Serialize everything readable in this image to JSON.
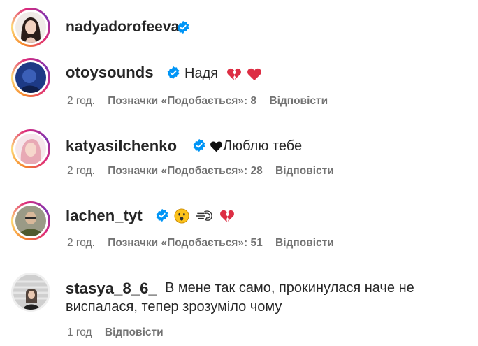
{
  "post_author": {
    "username": "nadyadorofeeva",
    "verified": true
  },
  "comments": [
    {
      "username": "otoysounds",
      "verified": true,
      "text": "Надя",
      "emojis": [
        "broken-heart-emoji",
        "red-heart-emoji"
      ],
      "time": "2 год.",
      "likes": "Позначки «Подобається»: 8",
      "reply": "Відповісти"
    },
    {
      "username": "katyasilchenko",
      "verified": true,
      "text": "Люблю тебе",
      "emojis": [
        "black-heart-emoji"
      ],
      "time": "2 год.",
      "likes": "Позначки «Подобається»: 28",
      "reply": "Відповісти"
    },
    {
      "username": "lachen_tyt",
      "verified": true,
      "text": "",
      "emojis": [
        "astonished-face-emoji",
        "dashing-away-emoji",
        "broken-heart-emoji"
      ],
      "time": "2 год.",
      "likes": "Позначки «Подобається»: 51",
      "reply": "Відповісти"
    },
    {
      "username": "stasya_8_6_",
      "verified": false,
      "text_line1": "В мене так само, прокинулася наче не",
      "text_line2": "виспалася, тепер зрозуміло чому",
      "time": "1 год",
      "reply": "Відповісти"
    }
  ],
  "colors": {
    "verified_blue": "#0095f6",
    "meta_gray": "#737373",
    "text": "#262626"
  }
}
